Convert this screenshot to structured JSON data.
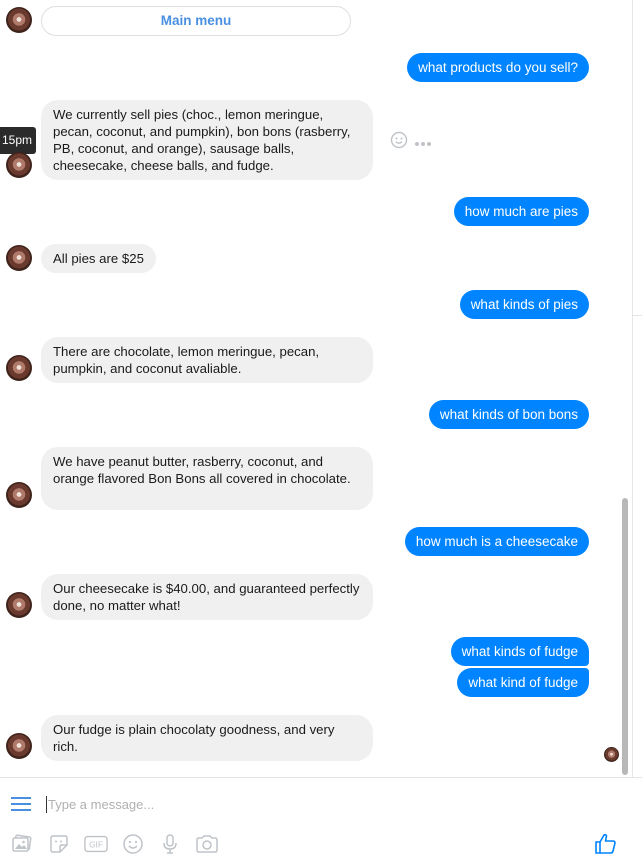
{
  "chat": {
    "main_menu_label": "Main menu",
    "tooltip_time": "15pm",
    "messages": [
      {
        "from": "user",
        "text": "what products do you sell?"
      },
      {
        "from": "bot",
        "text": "We currently sell pies (choc., lemon meringue, pecan, coconut, and pumpkin), bon bons (rasberry, PB, coconut, and orange), sausage balls, cheesecake, cheese balls, and fudge."
      },
      {
        "from": "user",
        "text": "how much are pies"
      },
      {
        "from": "bot",
        "text": "All pies are $25"
      },
      {
        "from": "user",
        "text": "what kinds of pies"
      },
      {
        "from": "bot",
        "text": "There are chocolate, lemon meringue, pecan, pumpkin, and coconut avaliable."
      },
      {
        "from": "user",
        "text": "what kinds of bon bons"
      },
      {
        "from": "bot",
        "text": "We have peanut butter, rasberry, coconut, and orange flavored Bon Bons all covered in chocolate."
      },
      {
        "from": "user",
        "text": "how much is a cheesecake"
      },
      {
        "from": "bot",
        "text": "Our cheesecake is $40.00, and guaranteed perfectly done, no matter what!"
      },
      {
        "from": "user",
        "text": "what kinds of fudge"
      },
      {
        "from": "user",
        "text": "what kind of fudge"
      },
      {
        "from": "bot",
        "text": "Our fudge is plain chocolaty goodness, and very rich."
      }
    ]
  },
  "composer": {
    "placeholder": "Type a message...",
    "tools": [
      "image-icon",
      "sticker-icon",
      "gif-icon",
      "emoji-icon",
      "microphone-icon",
      "camera-icon"
    ],
    "gif_label": "GIF"
  },
  "colors": {
    "outgoing_bubble": "#0084ff",
    "incoming_bubble": "#f1f0f0",
    "accent": "#4a90e2"
  }
}
